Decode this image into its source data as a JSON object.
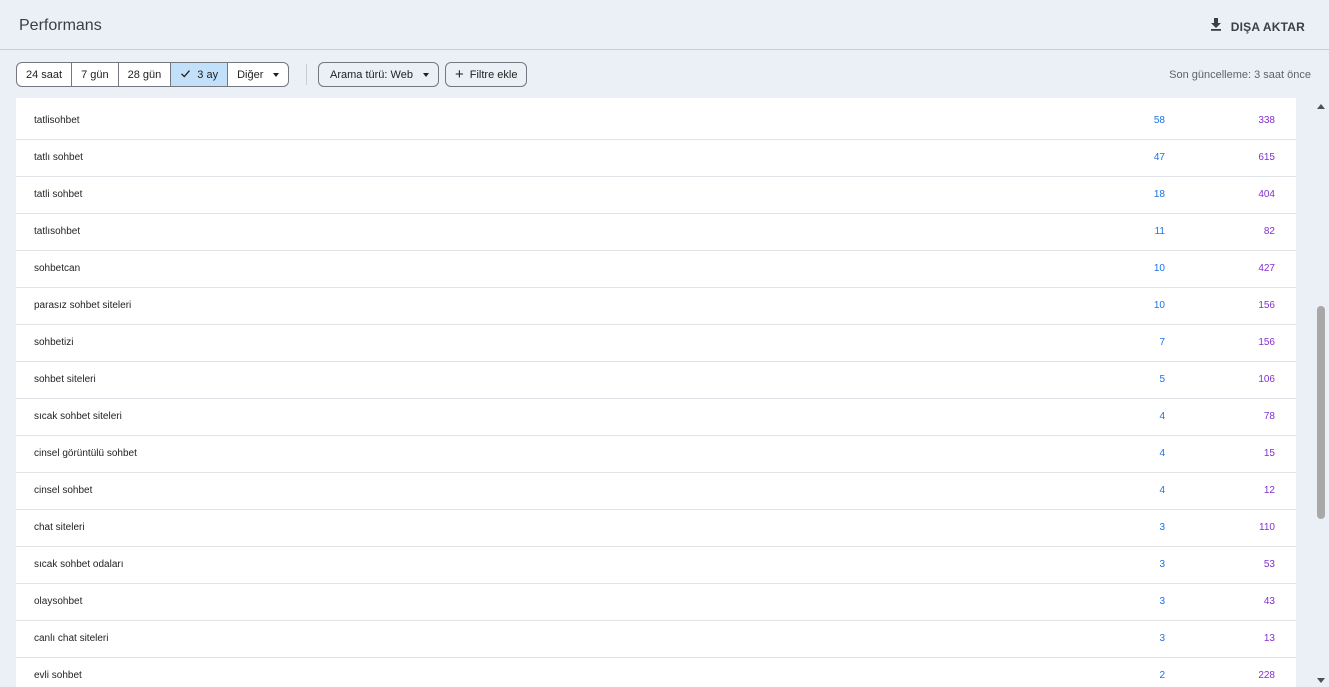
{
  "header": {
    "title": "Performans",
    "export_label": "DIŞA AKTAR"
  },
  "filters": {
    "date_ranges": [
      {
        "label": "24 saat",
        "active": false
      },
      {
        "label": "7 gün",
        "active": false
      },
      {
        "label": "28 gün",
        "active": false
      },
      {
        "label": "3 ay",
        "active": true
      }
    ],
    "more_label": "Diğer",
    "search_type_label": "Arama türü: Web",
    "add_filter_label": "Filtre ekle",
    "last_updated": "Son güncelleme: 3 saat önce"
  },
  "table": {
    "rows": [
      {
        "query": "tatlisohbet",
        "clicks": "58",
        "impressions": "338"
      },
      {
        "query": "tatlı sohbet",
        "clicks": "47",
        "impressions": "615"
      },
      {
        "query": "tatli sohbet",
        "clicks": "18",
        "impressions": "404"
      },
      {
        "query": "tatlısohbet",
        "clicks": "11",
        "impressions": "82"
      },
      {
        "query": "sohbetcan",
        "clicks": "10",
        "impressions": "427"
      },
      {
        "query": "parasız sohbet siteleri",
        "clicks": "10",
        "impressions": "156"
      },
      {
        "query": "sohbetizi",
        "clicks": "7",
        "impressions": "156"
      },
      {
        "query": "sohbet siteleri",
        "clicks": "5",
        "impressions": "106"
      },
      {
        "query": "sıcak sohbet siteleri",
        "clicks": "4",
        "impressions": "78"
      },
      {
        "query": "cinsel görüntülü sohbet",
        "clicks": "4",
        "impressions": "15"
      },
      {
        "query": "cinsel sohbet",
        "clicks": "4",
        "impressions": "12"
      },
      {
        "query": "chat siteleri",
        "clicks": "3",
        "impressions": "110"
      },
      {
        "query": "sıcak sohbet odaları",
        "clicks": "3",
        "impressions": "53"
      },
      {
        "query": "olaysohbet",
        "clicks": "3",
        "impressions": "43"
      },
      {
        "query": "canlı chat siteleri",
        "clicks": "3",
        "impressions": "13"
      },
      {
        "query": "evli sohbet",
        "clicks": "2",
        "impressions": "228"
      }
    ]
  },
  "colors": {
    "clicks": "#1a73e8",
    "impressions": "#8430ce",
    "active_chip": "#c3e0fb"
  }
}
